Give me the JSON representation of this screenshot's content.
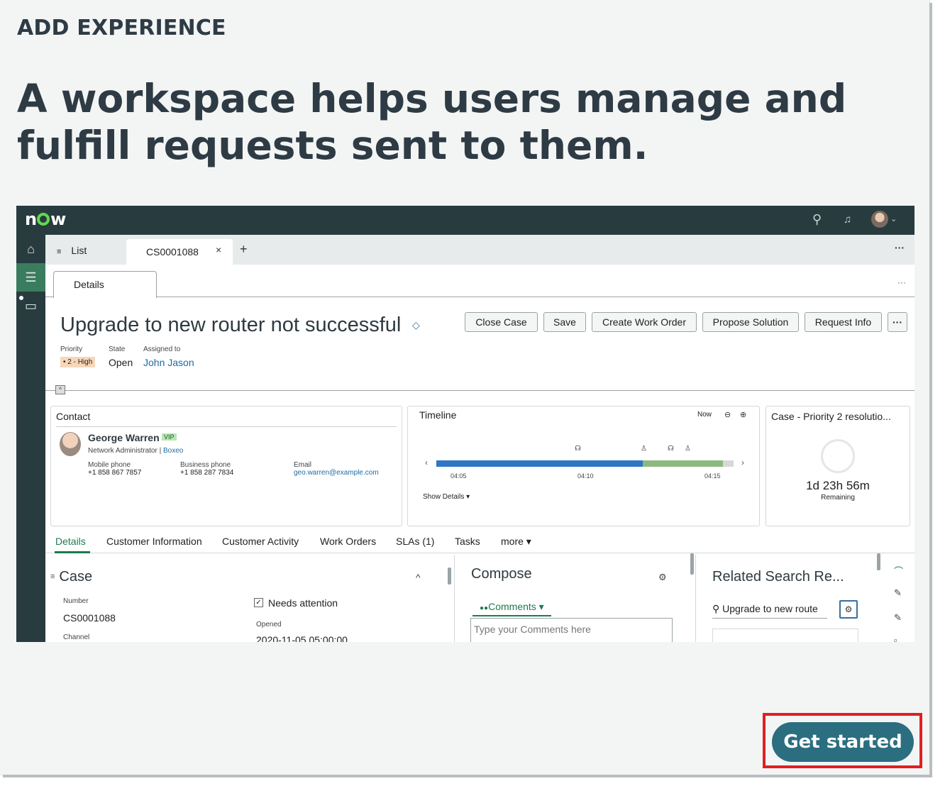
{
  "header": {
    "eyebrow": "ADD EXPERIENCE",
    "headline": "A workspace helps users manage and fulfill requests sent to them."
  },
  "workspace": {
    "logo": "now",
    "tabs": {
      "list_label": "List",
      "case_tab": "CS0001088",
      "close": "×",
      "add": "+",
      "more": "···"
    },
    "subtab": "Details",
    "subtab_more": "···",
    "case_title": "Upgrade to new router not successful",
    "actions": [
      "Close Case",
      "Save",
      "Create Work Order",
      "Propose Solution",
      "Request Info",
      "···"
    ],
    "meta": {
      "priority_label": "Priority",
      "priority_value": "• 2 - High",
      "state_label": "State",
      "state_value": "Open",
      "assigned_label": "Assigned to",
      "assigned_value": "John Jason"
    },
    "contact": {
      "title": "Contact",
      "name": "George Warren",
      "vip": "VIP",
      "role": "Network Administrator | ",
      "company": "Boxeo",
      "mobile_label": "Mobile phone",
      "mobile": "+1 858 867 7857",
      "business_label": "Business phone",
      "business": "+1 858 287 7834",
      "email_label": "Email",
      "email": "geo.warren@example.com"
    },
    "timeline": {
      "title": "Timeline",
      "now": "Now",
      "ticks": [
        "04:05",
        "04:10",
        "04:15"
      ],
      "show_details": "Show Details ▾"
    },
    "sla": {
      "title": "Case - Priority 2 resolutio...",
      "remaining_value": "1d 23h 56m",
      "remaining_label": "Remaining"
    },
    "lower_tabs": [
      "Details",
      "Customer Information",
      "Customer Activity",
      "Work Orders",
      "SLAs (1)",
      "Tasks",
      "more ▾"
    ],
    "case_section": {
      "title": "Case",
      "number_label": "Number",
      "number": "CS0001088",
      "channel_label": "Channel",
      "needs_attention": "Needs attention",
      "opened_label": "Opened",
      "opened": "2020-11-05 05:00:00"
    },
    "compose": {
      "title": "Compose",
      "comments": "Comments ▾",
      "placeholder": "Type your Comments here"
    },
    "related": {
      "title": "Related Search Re...",
      "query": "Upgrade to new route"
    }
  },
  "cta": {
    "label": "Get started"
  },
  "colors": {
    "brand_green": "#62d84e",
    "cta": "#2b6e80",
    "highlight": "#e02020",
    "nav": "#283b3f"
  }
}
